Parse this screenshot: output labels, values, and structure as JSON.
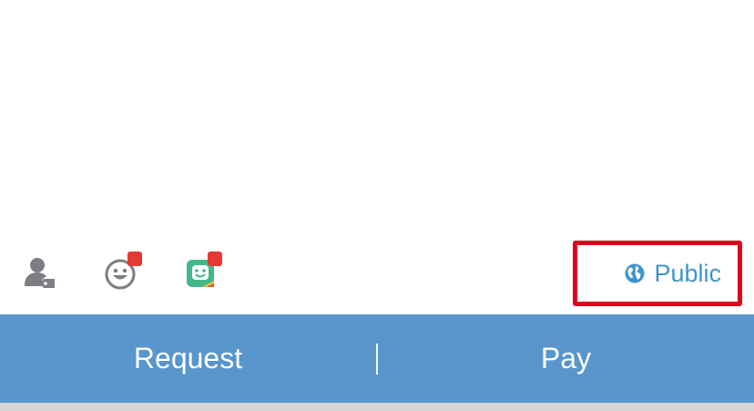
{
  "toolbar": {
    "icons": [
      {
        "icon": "person-tag-icon",
        "badge": false
      },
      {
        "icon": "smiley-icon",
        "badge": true
      },
      {
        "icon": "bitmoji-sticker-icon",
        "badge": true
      }
    ],
    "privacy": {
      "icon": "globe-icon",
      "label": "Public"
    }
  },
  "actions": {
    "request_label": "Request",
    "pay_label": "Pay"
  },
  "colors": {
    "action_bar": "#5896cb",
    "privacy_text": "#3d95ce",
    "highlight_border": "#e0001b",
    "badge": "#e53935"
  }
}
